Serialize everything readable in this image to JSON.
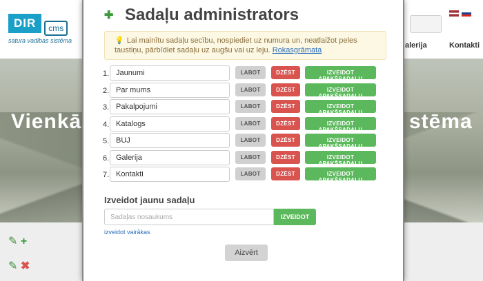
{
  "site": {
    "logo_main": "DIR",
    "logo_cms": "cms",
    "logo_subtitle": "satura vadības sistēma",
    "hero_title_left": "Vienkā",
    "hero_title_right": "stēma",
    "nav_item_1": "alerija",
    "nav_item_2": "Kontakti"
  },
  "modal": {
    "title": "Sadaļu administrators",
    "alert_text": "Lai mainītu sadaļu secību, nospiediet uz numura un, neatlaižot peles taustiņu, pārbīdiet sadaļu uz augšu vai uz leju.",
    "alert_link": "Rokasgrāmata",
    "edit_label": "LABOT",
    "delete_label": "DZĒST",
    "create_sub_label": "IZVEIDOT APAKŠSADAĻU",
    "sections": [
      {
        "num": "1.",
        "name": "Jaunumi"
      },
      {
        "num": "2.",
        "name": "Par mums"
      },
      {
        "num": "3.",
        "name": "Pakalpojumi"
      },
      {
        "num": "4.",
        "name": "Katalogs"
      },
      {
        "num": "5.",
        "name": "BUJ"
      },
      {
        "num": "6.",
        "name": "Galerija"
      },
      {
        "num": "7.",
        "name": "Kontakti"
      }
    ],
    "create_title": "Izveidot jaunu sadaļu",
    "create_placeholder": "Sadaļas nosaukums",
    "create_button": "IZVEIDOT",
    "create_more": "izveidot vairākas",
    "close_button": "Aizvērt"
  }
}
